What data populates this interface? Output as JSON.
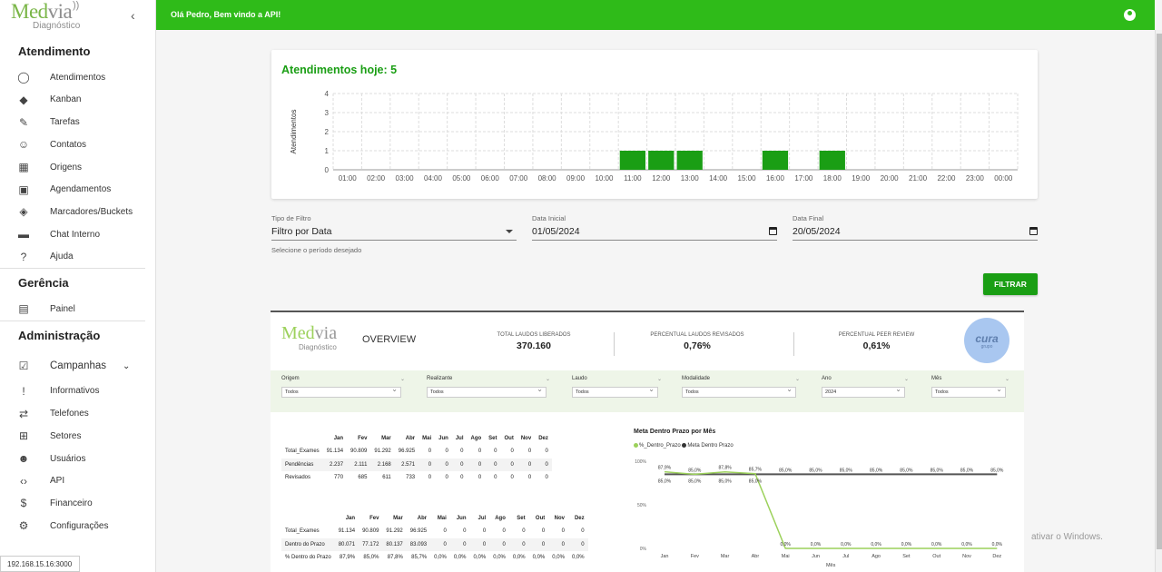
{
  "sidebar": {
    "logo_main": "Med",
    "logo_via": "via",
    "logo_sub": "Diagnóstico",
    "sections": [
      {
        "title": "Atendimento",
        "items": [
          {
            "label": "Atendimentos",
            "icon": "whatsapp-icon"
          },
          {
            "label": "Kanban",
            "icon": "tag-icon"
          },
          {
            "label": "Tarefas",
            "icon": "pencil-icon"
          },
          {
            "label": "Contatos",
            "icon": "contacts-icon"
          },
          {
            "label": "Origens",
            "icon": "building-icon"
          },
          {
            "label": "Agendamentos",
            "icon": "calendar-icon"
          },
          {
            "label": "Marcadores/Buckets",
            "icon": "tags-icon"
          },
          {
            "label": "Chat Interno",
            "icon": "chat-icon"
          },
          {
            "label": "Ajuda",
            "icon": "help-icon"
          }
        ]
      },
      {
        "title": "Gerência",
        "items": [
          {
            "label": "Painel",
            "icon": "dashboard-icon"
          }
        ]
      },
      {
        "title": "Administração",
        "items": [
          {
            "label": "Campanhas",
            "icon": "campaign-icon"
          },
          {
            "label": "Informativos",
            "icon": "announcement-icon"
          },
          {
            "label": "Telefones",
            "icon": "swap-icon"
          },
          {
            "label": "Setores",
            "icon": "sectors-icon"
          },
          {
            "label": "Usuários",
            "icon": "users-icon"
          },
          {
            "label": "API",
            "icon": "code-icon"
          },
          {
            "label": "Financeiro",
            "icon": "money-icon"
          },
          {
            "label": "Configurações",
            "icon": "gear-icon"
          }
        ]
      }
    ],
    "ip": "192.168.15.16:3000"
  },
  "topbar": {
    "greeting": "Olá Pedro, Bem vindo a API!"
  },
  "card": {
    "title": "Atendimentos hoje: 5"
  },
  "chart_data": {
    "type": "bar",
    "ylabel": "Atendimentos",
    "ylim": [
      0,
      4
    ],
    "yticks": [
      "0",
      "1",
      "2",
      "3",
      "4"
    ],
    "categories": [
      "01:00",
      "02:00",
      "03:00",
      "04:00",
      "05:00",
      "06:00",
      "07:00",
      "08:00",
      "09:00",
      "10:00",
      "11:00",
      "12:00",
      "13:00",
      "14:00",
      "15:00",
      "16:00",
      "17:00",
      "18:00",
      "19:00",
      "20:00",
      "21:00",
      "22:00",
      "23:00",
      "00:00"
    ],
    "values": [
      0,
      0,
      0,
      0,
      0,
      0,
      0,
      0,
      0,
      0,
      1,
      1,
      1,
      0,
      0,
      1,
      0,
      1,
      0,
      0,
      0,
      0,
      0,
      0
    ],
    "color": "#1a9e14",
    "grid": true
  },
  "filters": {
    "tipo": {
      "label": "Tipo de Filtro",
      "value": "Filtro por Data",
      "help": "Selecione o período desejado"
    },
    "inicial": {
      "label": "Data Inicial",
      "value": "01/05/2024"
    },
    "final": {
      "label": "Data Final",
      "value": "20/05/2024"
    },
    "button": "FILTRAR"
  },
  "report": {
    "logo_main": "Med",
    "logo_via": "via",
    "logo_sub": "Diagnóstico",
    "overview": "OVERVIEW",
    "kpis": [
      {
        "label": "TOTAL LAUDOS LIBERADOS",
        "value": "370.160"
      },
      {
        "label": "PERCENTUAL LAUDOS REVISADOS",
        "value": "0,76%"
      },
      {
        "label": "PERCENTUAL PEER REVIEW",
        "value": "0,61%"
      }
    ],
    "cura": "cura",
    "cura_sub": "grupo",
    "slicers": [
      {
        "name": "Origem",
        "value": "Todos"
      },
      {
        "name": "Realizante",
        "value": "Todos"
      },
      {
        "name": "Laudo",
        "value": "Todos"
      },
      {
        "name": "Modalidade",
        "value": "Todos"
      },
      {
        "name": "Ano",
        "value": "2024"
      },
      {
        "name": "Mês",
        "value": "Todos"
      }
    ],
    "table1": {
      "headers": [
        "",
        "Jan",
        "Fev",
        "Mar",
        "Abr",
        "Mai",
        "Jun",
        "Jul",
        "Ago",
        "Set",
        "Out",
        "Nov",
        "Dez"
      ],
      "rows": [
        [
          "Total_Exames",
          "91.134",
          "90.809",
          "91.292",
          "96.925",
          "0",
          "0",
          "0",
          "0",
          "0",
          "0",
          "0",
          "0"
        ],
        [
          "Pendências",
          "2.237",
          "2.111",
          "2.168",
          "2.571",
          "0",
          "0",
          "0",
          "0",
          "0",
          "0",
          "0",
          "0"
        ],
        [
          "Revisados",
          "770",
          "685",
          "611",
          "733",
          "0",
          "0",
          "0",
          "0",
          "0",
          "0",
          "0",
          "0"
        ]
      ]
    },
    "table2": {
      "headers": [
        "",
        "Jan",
        "Fev",
        "Mar",
        "Abr",
        "Mai",
        "Jun",
        "Jul",
        "Ago",
        "Set",
        "Out",
        "Nov",
        "Dez"
      ],
      "rows": [
        [
          "Total_Exames",
          "91.134",
          "90.809",
          "91.292",
          "96.925",
          "0",
          "0",
          "0",
          "0",
          "0",
          "0",
          "0",
          "0"
        ],
        [
          "Dentro do Prazo",
          "80.071",
          "77.172",
          "80.137",
          "83.093",
          "0",
          "0",
          "0",
          "0",
          "0",
          "0",
          "0",
          "0"
        ],
        [
          "% Dentro do Prazo",
          "87,9%",
          "85,0%",
          "87,8%",
          "85,7%",
          "0,0%",
          "0,0%",
          "0,0%",
          "0,0%",
          "0,0%",
          "0,0%",
          "0,0%",
          "0,0%"
        ]
      ]
    },
    "meta_chart": {
      "title": "Meta Dentro Prazo por Mês",
      "legend": [
        "%_Dentro_Prazo",
        "Meta Dentro Prazo"
      ],
      "xlabel": "Mês",
      "months": [
        "Jan",
        "Fev",
        "Mar",
        "Abr",
        "Mai",
        "Jun",
        "Jul",
        "Ago",
        "Set",
        "Out",
        "Nov",
        "Dez"
      ],
      "pct_labels": [
        "87,9%",
        "85,0%",
        "87,8%",
        "85,7%",
        "0,0%",
        "0,0%",
        "0,0%",
        "0,0%",
        "0,0%",
        "0,0%",
        "0,0%",
        "0,0%"
      ],
      "meta_labels": [
        "85,0%",
        "85,0%",
        "85,0%",
        "85,0%",
        "85,0%",
        "85,0%",
        "85,0%",
        "85,0%",
        "85,0%",
        "85,0%",
        "85,0%",
        "85,0%"
      ],
      "pct": [
        87.9,
        85.0,
        87.8,
        85.7,
        0,
        0,
        0,
        0,
        0,
        0,
        0,
        0
      ],
      "meta": [
        85,
        85,
        85,
        85,
        85,
        85,
        85,
        85,
        85,
        85,
        85,
        85
      ],
      "yticks": [
        "100%",
        "50%",
        "0%"
      ],
      "pct_color": "#9cd15b",
      "meta_color": "#555555"
    }
  },
  "watermark": "ativar o Windows."
}
